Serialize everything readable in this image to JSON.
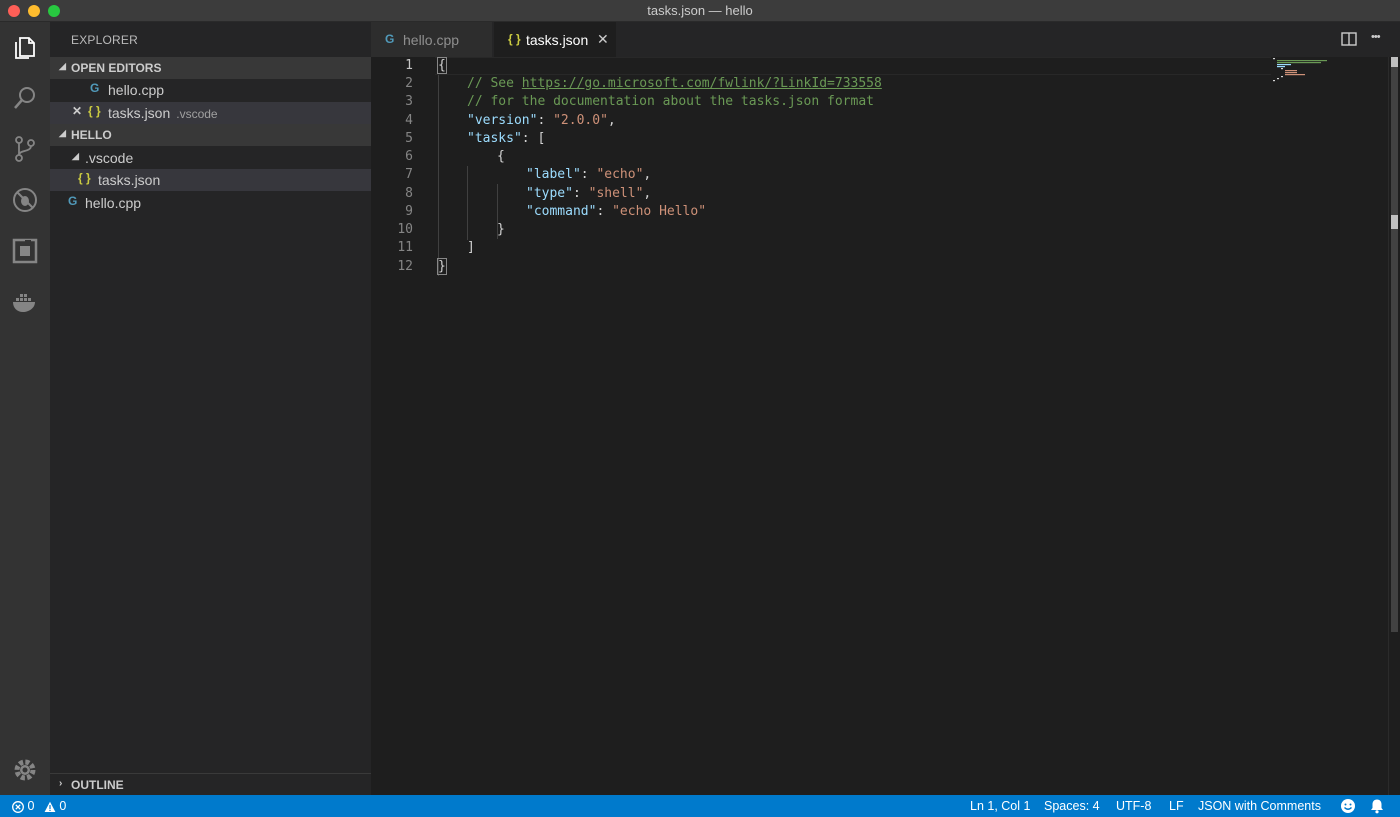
{
  "window": {
    "title": "tasks.json — hello"
  },
  "activity_bar": {
    "items": [
      {
        "name": "explorer-icon"
      },
      {
        "name": "search-icon"
      },
      {
        "name": "source-control-icon"
      },
      {
        "name": "debug-icon"
      },
      {
        "name": "extensions-icon"
      },
      {
        "name": "docker-icon"
      },
      {
        "name": "gear-icon"
      }
    ]
  },
  "sidebar": {
    "title": "EXPLORER",
    "open_editors": {
      "header": "OPEN EDITORS",
      "items": [
        {
          "icon": "G",
          "label": "hello.cpp",
          "description": ""
        },
        {
          "icon": "{ }",
          "label": "tasks.json",
          "description": ".vscode",
          "close": "✕"
        }
      ]
    },
    "workspace": {
      "header": "HELLO",
      "folder": ".vscode",
      "folder_child": {
        "icon": "{ }",
        "label": "tasks.json"
      },
      "file": {
        "icon": "G",
        "label": "hello.cpp"
      }
    },
    "outline": {
      "header": "OUTLINE"
    }
  },
  "tabs": [
    {
      "icon": "G",
      "label": "hello.cpp",
      "active": false
    },
    {
      "icon": "{ }",
      "label": "tasks.json",
      "active": true,
      "close": "✕"
    }
  ],
  "tab_actions": {
    "more": "•••"
  },
  "editor": {
    "line_numbers": [
      "1",
      "2",
      "3",
      "4",
      "5",
      "6",
      "7",
      "8",
      "9",
      "10",
      "11",
      "12"
    ],
    "active_line": 1,
    "lines": {
      "l1_brace": "{",
      "l2_comment": "// See ",
      "l2_link": "https://go.microsoft.com/fwlink/?LinkId=733558",
      "l3_comment": "// for the documentation about the tasks.json format",
      "l4_key": "\"version\"",
      "l4_sep": ": ",
      "l4_val": "\"2.0.0\"",
      "l4_end": ",",
      "l5_key": "\"tasks\"",
      "l5_end": ": [",
      "l6": "{",
      "l7_key": "\"label\"",
      "l7_sep": ": ",
      "l7_val": "\"echo\"",
      "l7_end": ",",
      "l8_key": "\"type\"",
      "l8_sep": ": ",
      "l8_val": "\"shell\"",
      "l8_end": ",",
      "l9_key": "\"command\"",
      "l9_sep": ": ",
      "l9_val": "\"echo Hello\"",
      "l10": "}",
      "l11": "]",
      "l12": "}"
    }
  },
  "status_bar": {
    "errors": "0",
    "warnings": "0",
    "position": "Ln 1, Col 1",
    "spaces": "Spaces: 4",
    "encoding": "UTF-8",
    "eol": "LF",
    "language": "JSON with Comments"
  },
  "colors": {
    "accent": "#007acc",
    "activity_bar": "#333333",
    "sidebar": "#252526",
    "editor": "#1e1e1e",
    "comment": "#6a9955",
    "key": "#9cdcfe",
    "string": "#ce9178"
  }
}
